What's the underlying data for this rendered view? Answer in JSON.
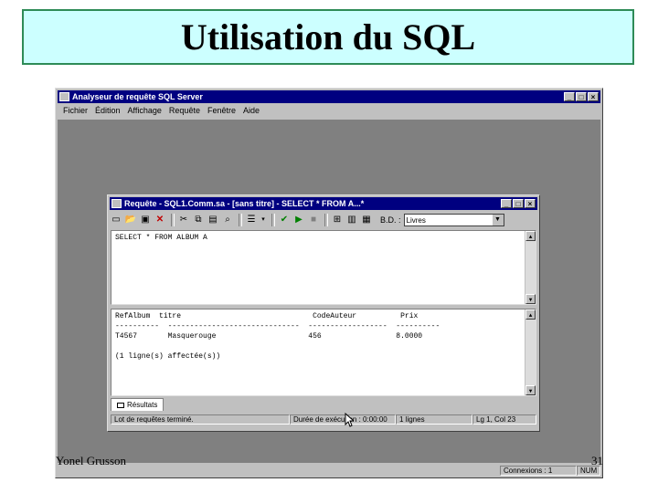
{
  "slide": {
    "title": "Utilisation du SQL",
    "author": "Yonel Grusson",
    "page_number": "31"
  },
  "app": {
    "title": "Analyseur de requête SQL Server",
    "menu": [
      "Fichier",
      "Édition",
      "Affichage",
      "Requête",
      "Fenêtre",
      "Aide"
    ],
    "status": {
      "connections": "Connexions : 1",
      "num": "NUM"
    }
  },
  "query_window": {
    "title": "Requête - SQL1.Comm.sa - [sans titre] - SELECT * FROM A...*",
    "toolbar": {
      "db_label": "B.D. :",
      "db_value": "Livres"
    },
    "query_text": "SELECT * FROM ALBUM A",
    "results": {
      "headers": [
        "RefAlbum",
        "titre",
        "CodeAuteur",
        "Prix"
      ],
      "rows": [
        [
          "T4567",
          "Masquerouge",
          "456",
          "8.0000"
        ]
      ],
      "message": "(1 ligne(s) affectée(s))"
    },
    "tab_label": "Résultats",
    "status": {
      "batch": "Lot de requêtes terminé.",
      "duration": "Durée de exécution : 0:00:00",
      "rows": "1 lignes",
      "position": "Lg 1, Col 23"
    }
  },
  "colors": {
    "banner_bg": "#ccffff",
    "banner_border": "#2e8b57",
    "titlebar": "#000080",
    "window_face": "#c0c0c0",
    "mdi_bg": "#808080"
  }
}
